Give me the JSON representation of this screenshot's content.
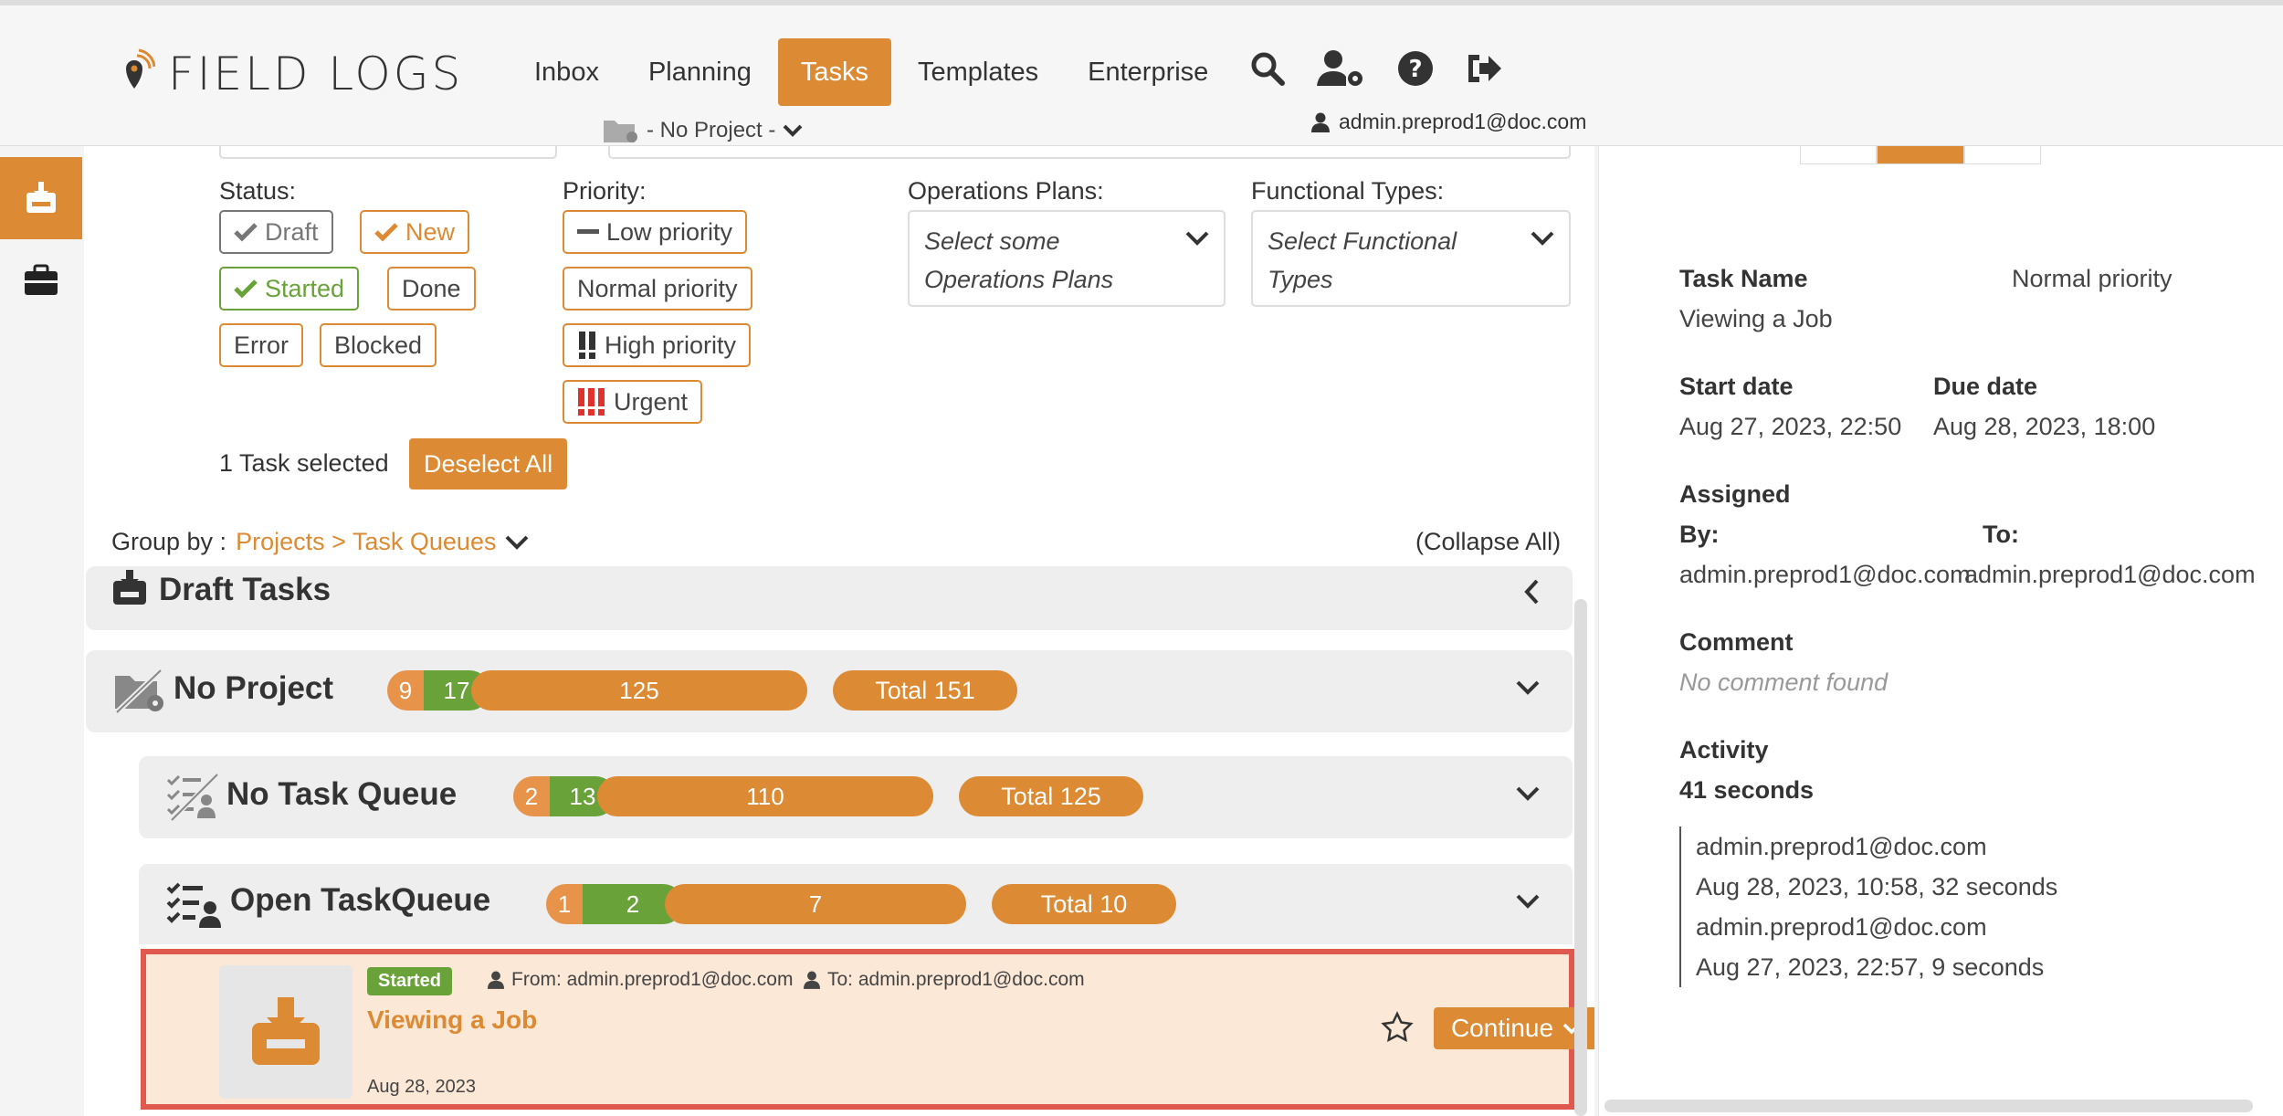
{
  "app": {
    "logo_text": "FIELD LOGS",
    "nav": [
      "Inbox",
      "Planning",
      "Tasks",
      "Templates",
      "Enterprise"
    ],
    "active_nav": "Tasks",
    "project_select": "- No Project -",
    "user": "admin.preprod1@doc.com",
    "icons": [
      "search-icon",
      "user-settings-icon",
      "help-icon",
      "logout-icon"
    ]
  },
  "sidebar": {
    "items": [
      "inbox-icon",
      "briefcase-icon"
    ]
  },
  "filters": {
    "status_label": "Status:",
    "status": [
      "Draft",
      "New",
      "Started",
      "Done",
      "Error",
      "Blocked"
    ],
    "priority_label": "Priority:",
    "priority": [
      "Low priority",
      "Normal priority",
      "High priority",
      "Urgent"
    ],
    "ops_label": "Operations Plans:",
    "ops_placeholder_1": "Select some",
    "ops_placeholder_2": "Operations Plans",
    "func_label": "Functional Types:",
    "func_placeholder_1": "Select Functional",
    "func_placeholder_2": "Types"
  },
  "selection": {
    "text": "1 Task selected",
    "button": "Deselect All"
  },
  "group_by": {
    "label": "Group by :",
    "value": "Projects > Task Queues",
    "collapse": "(Collapse All)"
  },
  "groups": {
    "draft": {
      "title": "Draft Tasks"
    },
    "no_project": {
      "title": "No Project",
      "bar": [
        9,
        17,
        125
      ],
      "total": "Total 151"
    },
    "no_task_queue": {
      "title": "No Task Queue",
      "bar": [
        2,
        13,
        110
      ],
      "total": "Total 125"
    },
    "open_task_queue": {
      "title": "Open TaskQueue",
      "bar": [
        1,
        2,
        7
      ],
      "total": "Total 10"
    }
  },
  "task": {
    "status": "Started",
    "from": "From: admin.preprod1@doc.com",
    "to": "To: admin.preprod1@doc.com",
    "name": "Viewing a Job",
    "date": "Aug 28, 2023",
    "action": "Continue"
  },
  "details": {
    "task_name_label": "Task Name",
    "task_name": "Viewing a Job",
    "priority": "Normal priority",
    "start_label": "Start date",
    "start": "Aug 27, 2023, 22:50",
    "due_label": "Due date",
    "due": "Aug 28, 2023, 18:00",
    "assigned_label": "Assigned",
    "by_label": "By:",
    "to_label": "To:",
    "by": "admin.preprod1@doc.com",
    "to": "admin.preprod1@doc.com",
    "comment_label": "Comment",
    "comment": "No comment found",
    "activity_label": "Activity",
    "activity_duration": "41 seconds",
    "activity": [
      "admin.preprod1@doc.com",
      "Aug 28, 2023, 10:58, 32 seconds",
      "admin.preprod1@doc.com",
      "Aug 27, 2023, 22:57, 9 seconds"
    ]
  },
  "colors": {
    "accent": "#dc8a33",
    "green": "#6aa23a",
    "highlight_border": "#e0594f",
    "urgent": "#e0322d"
  }
}
